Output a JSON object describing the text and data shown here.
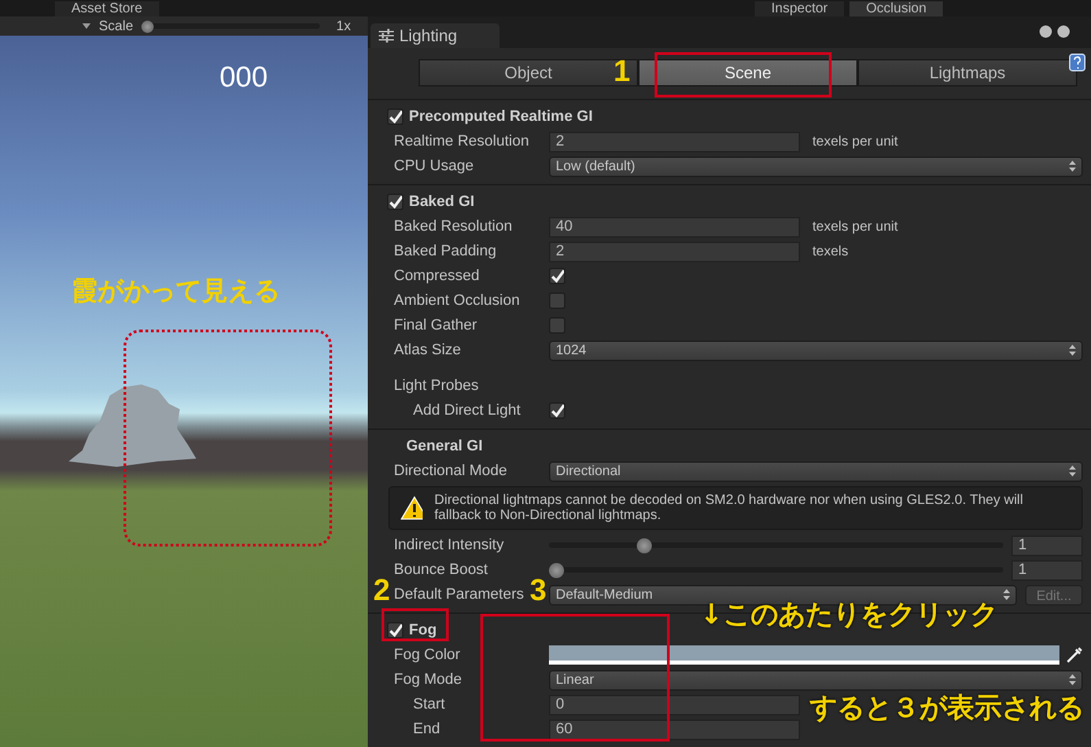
{
  "top_bar": {
    "tab": "Asset Store"
  },
  "game_toolbar": {
    "scale_label": "Scale",
    "scale_slider": {
      "level": 0
    },
    "scale_value": "1x"
  },
  "game_view": {
    "score": "000",
    "annotation": "霞がかって見える"
  },
  "inspector_tabs": [
    {
      "label": "Inspector",
      "selected": false
    },
    {
      "label": "Occlusion",
      "selected": true
    }
  ],
  "lighting": {
    "title": "Lighting",
    "mode_tabs": [
      {
        "label": "Object",
        "selected": false
      },
      {
        "label": "Scene",
        "selected": true
      },
      {
        "label": "Lightmaps",
        "selected": false
      }
    ],
    "sections": [
      {
        "kind": "toggle",
        "title": "Precomputed Realtime GI",
        "checked": true,
        "rows": [
          {
            "kind": "field",
            "label": "Realtime Resolution",
            "value": "2",
            "unit": "texels per unit"
          },
          {
            "kind": "dropdown",
            "label": "CPU Usage",
            "value": "Low (default)"
          }
        ]
      },
      {
        "kind": "toggle",
        "title": "Baked GI",
        "checked": true,
        "rows": [
          {
            "kind": "field",
            "label": "Baked Resolution",
            "value": "40",
            "unit": "texels per unit"
          },
          {
            "kind": "field",
            "label": "Baked Padding",
            "value": "2",
            "unit": "texels"
          },
          {
            "kind": "checkbox",
            "label": "Compressed",
            "checked": true
          },
          {
            "kind": "checkbox",
            "label": "Ambient Occlusion",
            "checked": false
          },
          {
            "kind": "checkbox",
            "label": "Final Gather",
            "checked": false
          },
          {
            "kind": "dropdown",
            "label": "Atlas Size",
            "value": "1024"
          },
          {
            "kind": "group",
            "label": "Light Probes",
            "children": [
              {
                "kind": "checkbox",
                "label": "Add Direct Light",
                "checked": true
              }
            ]
          }
        ]
      },
      {
        "kind": "heading",
        "title": "General GI",
        "rows": [
          {
            "kind": "dropdown",
            "label": "Directional Mode",
            "value": "Directional"
          },
          {
            "kind": "warning",
            "text": "Directional lightmaps cannot be decoded on SM2.0 hardware nor when using GLES2.0. They will fallback to Non-Directional lightmaps."
          },
          {
            "kind": "slider",
            "label": "Indirect Intensity",
            "level": 0.2,
            "value": "1"
          },
          {
            "kind": "slider",
            "label": "Bounce Boost",
            "level": 0,
            "value": "1"
          },
          {
            "kind": "dropdown_button",
            "label": "Default Parameters",
            "value": "Default-Medium",
            "button": "Edit..."
          }
        ]
      },
      {
        "kind": "toggle",
        "title": "Fog",
        "checked": true,
        "rows": [
          {
            "kind": "color",
            "label": "Fog Color",
            "color": "#8e9fad"
          },
          {
            "kind": "dropdown",
            "label": "Fog Mode",
            "value": "Linear",
            "children": [
              {
                "kind": "field",
                "label": "Start",
                "value": "0"
              },
              {
                "kind": "field",
                "label": "End",
                "value": "60"
              }
            ]
          }
        ]
      }
    ]
  },
  "annotations": [
    {
      "kind": "step",
      "text": "1"
    },
    {
      "kind": "step",
      "text": "2"
    },
    {
      "kind": "step",
      "text": "3"
    },
    {
      "kind": "note",
      "text": "↓このあたりをクリック"
    },
    {
      "kind": "note",
      "text": "すると３が表示される"
    }
  ]
}
